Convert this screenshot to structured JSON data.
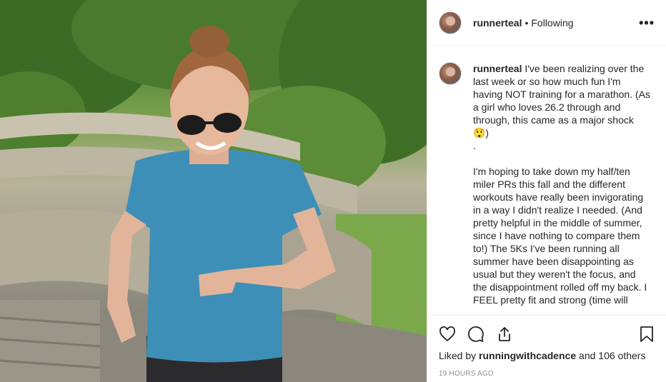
{
  "post": {
    "photo_description_icon": "photo"
  },
  "header": {
    "username": "runnerteal",
    "separator": "•",
    "follow_status": "Following",
    "more_icon": "more-options-icon",
    "more_glyph": "•••"
  },
  "caption": {
    "username": "runnerteal",
    "text": "I've been realizing over the last week or so how much fun I'm having NOT training for a marathon. (As a girl who loves 26.2 through and through, this came as a major shock 😲)\n.\n\nI'm hoping to take down my half/ten miler PRs this fall and the different workouts have really been invigorating in a way I didn't realize I needed. (And pretty helpful in the middle of summer, since I have nothing to compare them to!) The 5Ks I've been running all summer have been disappointing as usual but they weren't the focus, and the disappointment rolled off my back. I FEEL pretty fit and strong (time will"
  },
  "actions": {
    "like_icon": "heart-icon",
    "comment_icon": "comment-icon",
    "share_icon": "share-icon",
    "save_icon": "bookmark-icon"
  },
  "likes": {
    "prefix": "Liked by ",
    "liker": "runningwithcadence",
    "suffix": " and 106 others"
  },
  "timestamp": "19 HOURS AGO",
  "colors": {
    "text": "#262626",
    "muted": "#8e8e8e",
    "border": "#efefef"
  }
}
